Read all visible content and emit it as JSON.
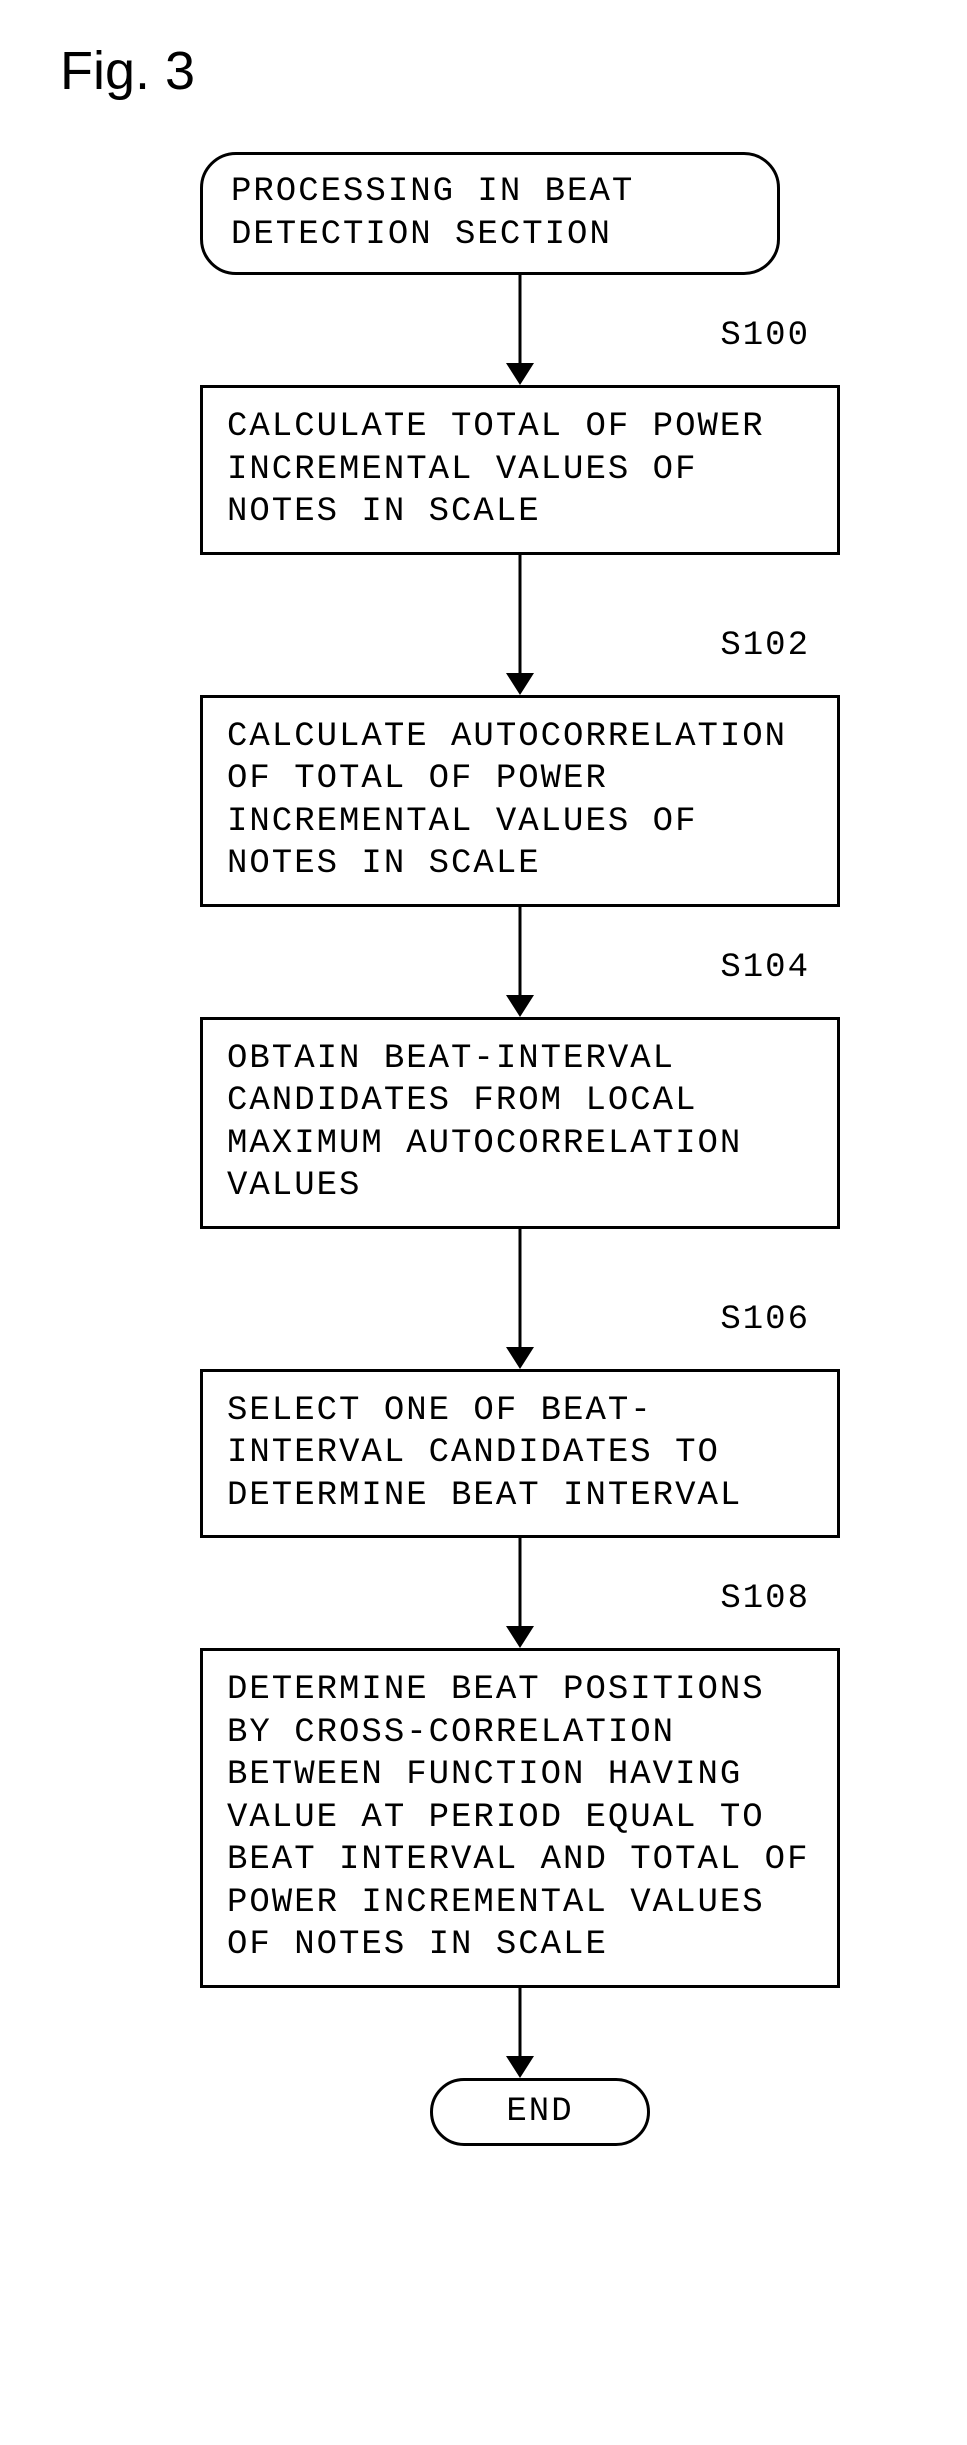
{
  "figure_label": "Fig. 3",
  "start": "PROCESSING IN BEAT DETECTION SECTION",
  "steps": {
    "s100": {
      "label": "S100",
      "text": "CALCULATE TOTAL OF POWER INCREMENTAL VALUES OF NOTES IN SCALE"
    },
    "s102": {
      "label": "S102",
      "text": "CALCULATE AUTOCORRELATION OF TOTAL OF POWER INCREMENTAL VALUES OF NOTES IN SCALE"
    },
    "s104": {
      "label": "S104",
      "text": "OBTAIN BEAT-INTERVAL CANDIDATES FROM LOCAL MAXIMUM AUTOCORRELATION VALUES"
    },
    "s106": {
      "label": "S106",
      "text": "SELECT ONE OF BEAT-INTERVAL CANDIDATES TO DETERMINE BEAT INTERVAL"
    },
    "s108": {
      "label": "S108",
      "text": "DETERMINE BEAT POSITIONS BY CROSS-CORRELATION BETWEEN FUNCTION HAVING VALUE AT PERIOD EQUAL TO BEAT INTERVAL AND TOTAL OF POWER INCREMENTAL VALUES OF NOTES IN SCALE"
    }
  },
  "end": "END"
}
